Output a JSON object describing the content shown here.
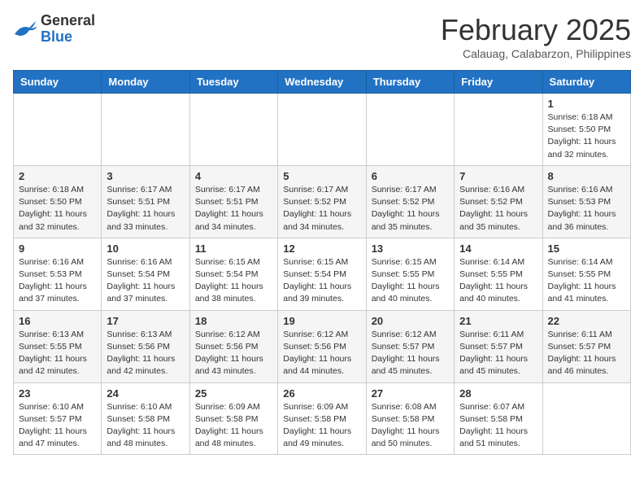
{
  "header": {
    "logo_line1": "General",
    "logo_line2": "Blue",
    "month_title": "February 2025",
    "location": "Calauag, Calabarzon, Philippines"
  },
  "weekdays": [
    "Sunday",
    "Monday",
    "Tuesday",
    "Wednesday",
    "Thursday",
    "Friday",
    "Saturday"
  ],
  "weeks": [
    [
      {
        "day": "",
        "info": ""
      },
      {
        "day": "",
        "info": ""
      },
      {
        "day": "",
        "info": ""
      },
      {
        "day": "",
        "info": ""
      },
      {
        "day": "",
        "info": ""
      },
      {
        "day": "",
        "info": ""
      },
      {
        "day": "1",
        "info": "Sunrise: 6:18 AM\nSunset: 5:50 PM\nDaylight: 11 hours\nand 32 minutes."
      }
    ],
    [
      {
        "day": "2",
        "info": "Sunrise: 6:18 AM\nSunset: 5:50 PM\nDaylight: 11 hours\nand 32 minutes."
      },
      {
        "day": "3",
        "info": "Sunrise: 6:17 AM\nSunset: 5:51 PM\nDaylight: 11 hours\nand 33 minutes."
      },
      {
        "day": "4",
        "info": "Sunrise: 6:17 AM\nSunset: 5:51 PM\nDaylight: 11 hours\nand 34 minutes."
      },
      {
        "day": "5",
        "info": "Sunrise: 6:17 AM\nSunset: 5:52 PM\nDaylight: 11 hours\nand 34 minutes."
      },
      {
        "day": "6",
        "info": "Sunrise: 6:17 AM\nSunset: 5:52 PM\nDaylight: 11 hours\nand 35 minutes."
      },
      {
        "day": "7",
        "info": "Sunrise: 6:16 AM\nSunset: 5:52 PM\nDaylight: 11 hours\nand 35 minutes."
      },
      {
        "day": "8",
        "info": "Sunrise: 6:16 AM\nSunset: 5:53 PM\nDaylight: 11 hours\nand 36 minutes."
      }
    ],
    [
      {
        "day": "9",
        "info": "Sunrise: 6:16 AM\nSunset: 5:53 PM\nDaylight: 11 hours\nand 37 minutes."
      },
      {
        "day": "10",
        "info": "Sunrise: 6:16 AM\nSunset: 5:54 PM\nDaylight: 11 hours\nand 37 minutes."
      },
      {
        "day": "11",
        "info": "Sunrise: 6:15 AM\nSunset: 5:54 PM\nDaylight: 11 hours\nand 38 minutes."
      },
      {
        "day": "12",
        "info": "Sunrise: 6:15 AM\nSunset: 5:54 PM\nDaylight: 11 hours\nand 39 minutes."
      },
      {
        "day": "13",
        "info": "Sunrise: 6:15 AM\nSunset: 5:55 PM\nDaylight: 11 hours\nand 40 minutes."
      },
      {
        "day": "14",
        "info": "Sunrise: 6:14 AM\nSunset: 5:55 PM\nDaylight: 11 hours\nand 40 minutes."
      },
      {
        "day": "15",
        "info": "Sunrise: 6:14 AM\nSunset: 5:55 PM\nDaylight: 11 hours\nand 41 minutes."
      }
    ],
    [
      {
        "day": "16",
        "info": "Sunrise: 6:13 AM\nSunset: 5:55 PM\nDaylight: 11 hours\nand 42 minutes."
      },
      {
        "day": "17",
        "info": "Sunrise: 6:13 AM\nSunset: 5:56 PM\nDaylight: 11 hours\nand 42 minutes."
      },
      {
        "day": "18",
        "info": "Sunrise: 6:12 AM\nSunset: 5:56 PM\nDaylight: 11 hours\nand 43 minutes."
      },
      {
        "day": "19",
        "info": "Sunrise: 6:12 AM\nSunset: 5:56 PM\nDaylight: 11 hours\nand 44 minutes."
      },
      {
        "day": "20",
        "info": "Sunrise: 6:12 AM\nSunset: 5:57 PM\nDaylight: 11 hours\nand 45 minutes."
      },
      {
        "day": "21",
        "info": "Sunrise: 6:11 AM\nSunset: 5:57 PM\nDaylight: 11 hours\nand 45 minutes."
      },
      {
        "day": "22",
        "info": "Sunrise: 6:11 AM\nSunset: 5:57 PM\nDaylight: 11 hours\nand 46 minutes."
      }
    ],
    [
      {
        "day": "23",
        "info": "Sunrise: 6:10 AM\nSunset: 5:57 PM\nDaylight: 11 hours\nand 47 minutes."
      },
      {
        "day": "24",
        "info": "Sunrise: 6:10 AM\nSunset: 5:58 PM\nDaylight: 11 hours\nand 48 minutes."
      },
      {
        "day": "25",
        "info": "Sunrise: 6:09 AM\nSunset: 5:58 PM\nDaylight: 11 hours\nand 48 minutes."
      },
      {
        "day": "26",
        "info": "Sunrise: 6:09 AM\nSunset: 5:58 PM\nDaylight: 11 hours\nand 49 minutes."
      },
      {
        "day": "27",
        "info": "Sunrise: 6:08 AM\nSunset: 5:58 PM\nDaylight: 11 hours\nand 50 minutes."
      },
      {
        "day": "28",
        "info": "Sunrise: 6:07 AM\nSunset: 5:58 PM\nDaylight: 11 hours\nand 51 minutes."
      },
      {
        "day": "",
        "info": ""
      }
    ]
  ]
}
